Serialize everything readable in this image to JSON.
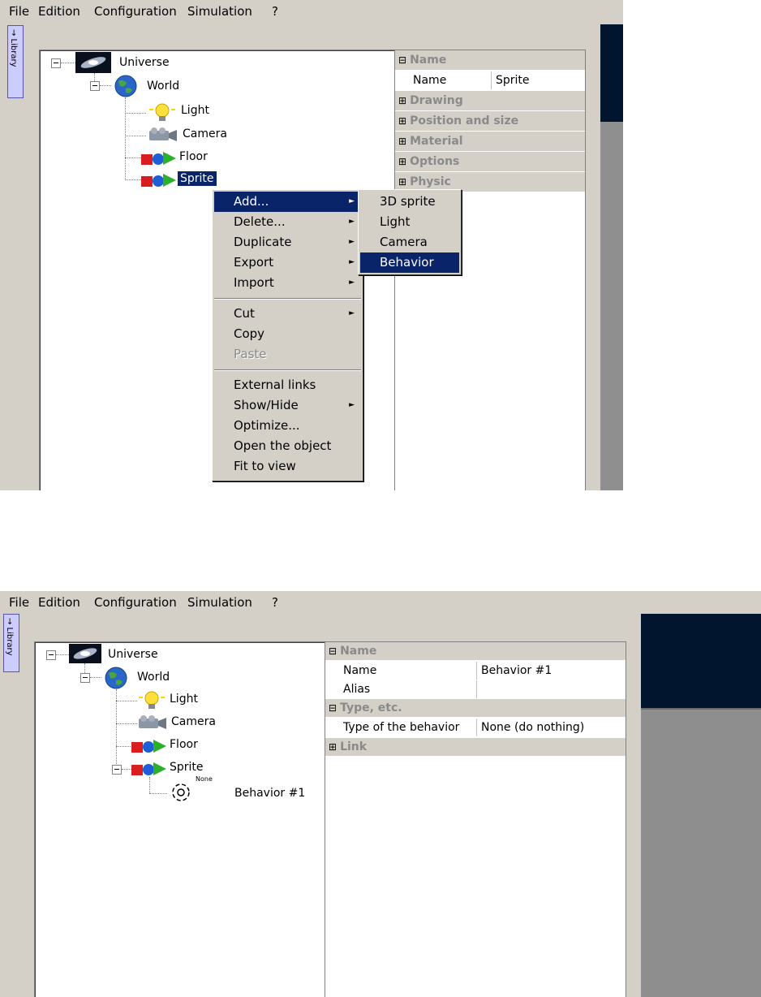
{
  "menubar": [
    "File",
    "Edition",
    "Configuration",
    "Simulation",
    "?"
  ],
  "library_tab": "→ Library",
  "tree": {
    "universe": "Universe",
    "world": "World",
    "light": "Light",
    "camera": "Camera",
    "floor": "Floor",
    "sprite": "Sprite",
    "behavior": "Behavior #1",
    "behavior_badge": "None"
  },
  "props_top": {
    "name_header": "Name",
    "name_key": "Name",
    "name_value": "Sprite",
    "drawing": "Drawing",
    "position": "Position and size",
    "material": "Material",
    "options": "Options",
    "physic": "Physic"
  },
  "context_menu": {
    "add": "Add...",
    "delete": "Delete...",
    "duplicate": "Duplicate",
    "export": "Export",
    "import": "Import",
    "cut": "Cut",
    "copy": "Copy",
    "paste": "Paste",
    "external_links": "External links",
    "show_hide": "Show/Hide",
    "optimize": "Optimize...",
    "open_object": "Open the object",
    "fit_to_view": "Fit to view"
  },
  "submenu": {
    "sprite3d": "3D sprite",
    "light": "Light",
    "camera": "Camera",
    "behavior": "Behavior"
  },
  "props_bottom": {
    "name_header": "Name",
    "name_key": "Name",
    "name_value": "Behavior #1",
    "alias_key": "Alias",
    "alias_value": "",
    "type_header": "Type, etc.",
    "type_key": "Type of the behavior",
    "type_value": "None (do nothing)",
    "link": "Link"
  },
  "symbols": {
    "collapse": "⊟",
    "expand": "⊞",
    "submenu_arrow": "►"
  },
  "colors": {
    "selection": "#0a246a",
    "window": "#d4d0c8",
    "viewport_dark": "#02152e"
  }
}
